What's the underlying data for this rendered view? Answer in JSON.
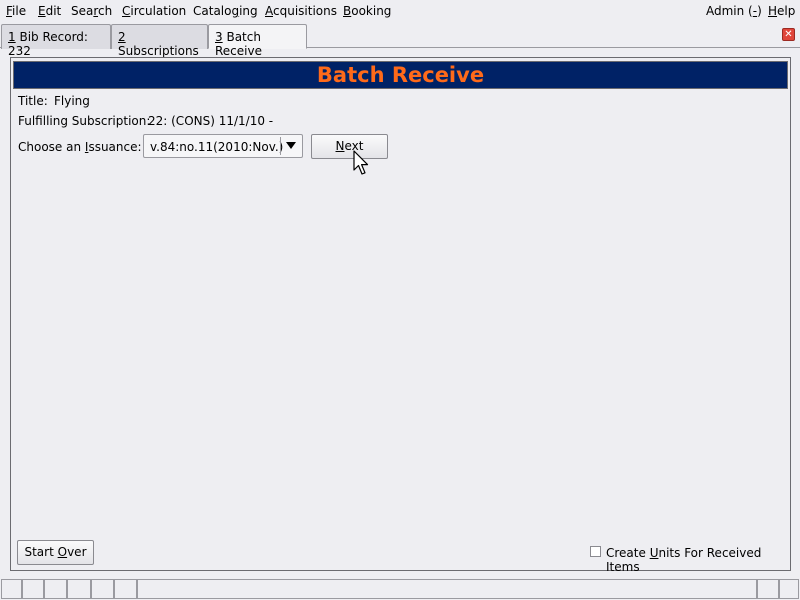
{
  "menu": {
    "items": [
      {
        "pre": "",
        "key": "F",
        "post": "ile"
      },
      {
        "pre": "",
        "key": "E",
        "post": "dit"
      },
      {
        "pre": "Sea",
        "key": "r",
        "post": "ch"
      },
      {
        "pre": "",
        "key": "C",
        "post": "irculation"
      },
      {
        "pre": "Catalo",
        "key": "g",
        "post": "ing"
      },
      {
        "pre": "",
        "key": "A",
        "post": "cquisitions"
      },
      {
        "pre": "",
        "key": "B",
        "post": "ooking"
      }
    ],
    "admin": {
      "pre": "Admin (",
      "key": "-",
      "post": ")"
    },
    "help": {
      "pre": "",
      "key": "H",
      "post": "elp"
    }
  },
  "tabs": [
    {
      "num": "1",
      "label": " Bib Record: 232"
    },
    {
      "num": "2",
      "label": " Subscriptions"
    },
    {
      "num": "3",
      "label": " Batch Receive"
    }
  ],
  "close_glyph": "✕",
  "banner": "Batch Receive",
  "fields": {
    "title_label": "Title:",
    "title_value": "Flying",
    "subscription_label": "Fulfilling Subscription:",
    "subscription_value": "22: (CONS) 11/1/10 -",
    "issuance_label_pre": "Choose an ",
    "issuance_label_key": "I",
    "issuance_label_post": "ssuance:",
    "issuance_value": "v.84:no.11(2010:Nov.)"
  },
  "buttons": {
    "next": {
      "key": "N",
      "post": "ext"
    },
    "start_over": {
      "pre": "Start ",
      "key": "O",
      "post": "ver"
    }
  },
  "checkbox": {
    "pre": "Create ",
    "key": "U",
    "post": "nits For Received Items",
    "checked": false
  }
}
